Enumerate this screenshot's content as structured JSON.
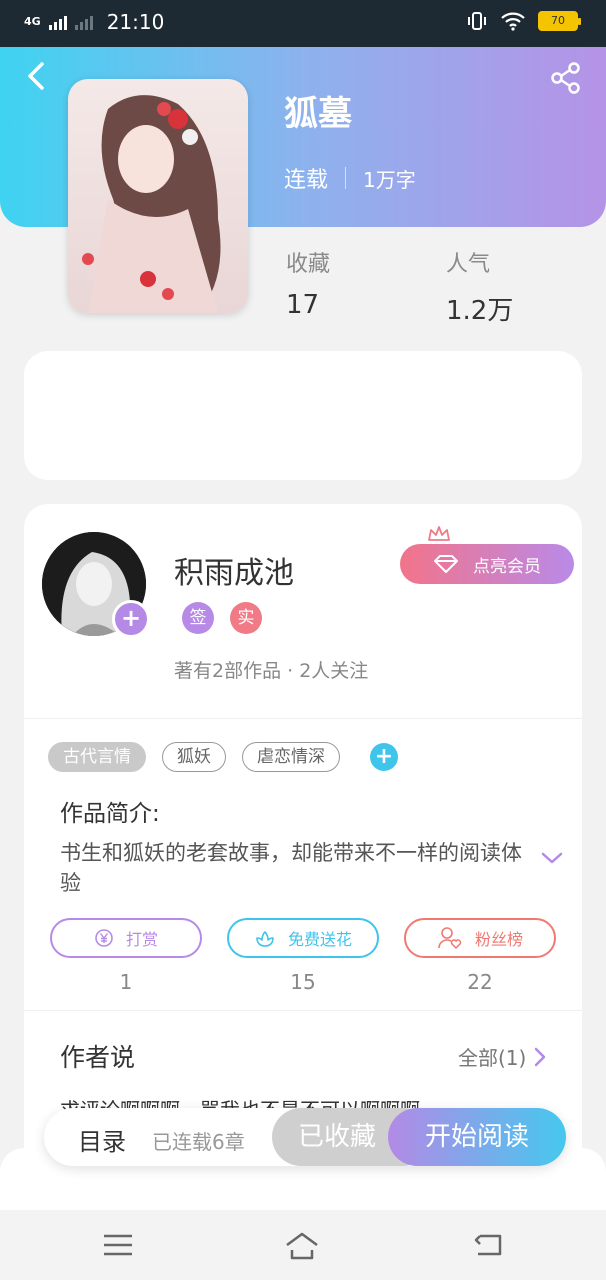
{
  "status_bar": {
    "network": "4G",
    "time": "21:10",
    "battery": "70"
  },
  "header": {
    "back_icon": "chevron-left-icon",
    "share_icon": "share-icon"
  },
  "book": {
    "title": "狐墓",
    "status": "连载",
    "word_count": "1万字",
    "stats": [
      {
        "label": "收藏",
        "value": "17"
      },
      {
        "label": "人气",
        "value": "1.2万"
      }
    ]
  },
  "author": {
    "name": "积雨成池",
    "badges": [
      {
        "label": "签",
        "color": "#b88ae8"
      },
      {
        "label": "实",
        "color": "#f07a86"
      }
    ],
    "works_info": "著有2部作品 · 2人关注",
    "vip_button": "点亮会员"
  },
  "tags": [
    "古代言情",
    "狐妖",
    "虐恋情深"
  ],
  "intro": {
    "title": "作品简介:",
    "text": "书生和狐妖的老套故事，却能带来不一样的阅读体验"
  },
  "actions": [
    {
      "label": "打赏",
      "count": "1",
      "color": "#b88ae8",
      "icon": "yen-coin-icon"
    },
    {
      "label": "免费送花",
      "count": "15",
      "color": "#3fc4ec",
      "icon": "flower-icon"
    },
    {
      "label": "粉丝榜",
      "count": "22",
      "color": "#f07a72",
      "icon": "fan-user-icon"
    }
  ],
  "author_says": {
    "title": "作者说",
    "all_label": "全部(1)",
    "preview": "求评论啊啊啊，骂我也不是不可以啊啊啊"
  },
  "bottom_bar": {
    "toc_label": "目录",
    "toc_status": "已连载6章",
    "collected_label": "已收藏",
    "read_label": "开始阅读"
  },
  "colors": {
    "header_gradient": [
      "#3fd3f1",
      "#8db2ee",
      "#b593e6"
    ],
    "accent_purple": "#b48ae6",
    "accent_cyan": "#3fc4ec"
  }
}
